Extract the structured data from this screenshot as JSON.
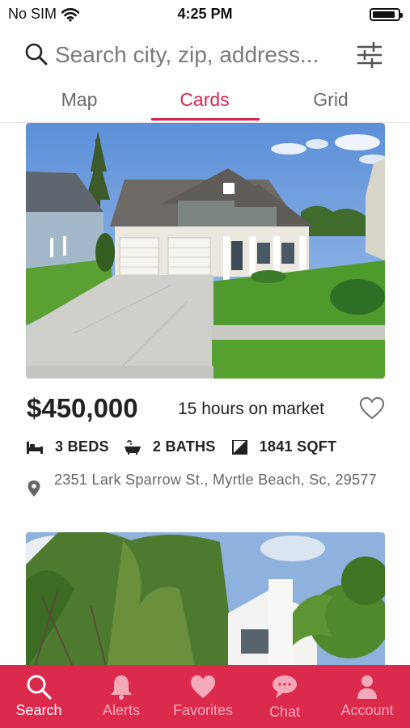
{
  "status_bar": {
    "carrier": "No SIM",
    "time": "4:25 PM",
    "battery_level": 0.9
  },
  "search": {
    "placeholder": "Search city, zip, address...",
    "value": ""
  },
  "tabs": [
    {
      "label": "Map",
      "active": false
    },
    {
      "label": "Cards",
      "active": true
    },
    {
      "label": "Grid",
      "active": false
    }
  ],
  "listings": [
    {
      "price": "$450,000",
      "market_time": "15 hours on market",
      "beds": "3 BEDS",
      "baths": "2 BATHS",
      "sqft": "1841 SQFT",
      "address": "2351 Lark Sparrow St., Myrtle Beach, Sc, 29577",
      "favorited": false
    }
  ],
  "bottom_nav": [
    {
      "label": "Search",
      "icon": "search-icon",
      "active": true
    },
    {
      "label": "Alerts",
      "icon": "bell-icon",
      "active": false
    },
    {
      "label": "Favorites",
      "icon": "heart-icon",
      "active": false
    },
    {
      "label": "Chat",
      "icon": "chat-bubble-icon",
      "active": false
    },
    {
      "label": "Account",
      "icon": "person-icon",
      "active": false
    }
  ],
  "colors": {
    "accent": "#dc2a4d",
    "tab_active": "#d6274c",
    "nav_inactive_label": "#f4a9b9"
  }
}
